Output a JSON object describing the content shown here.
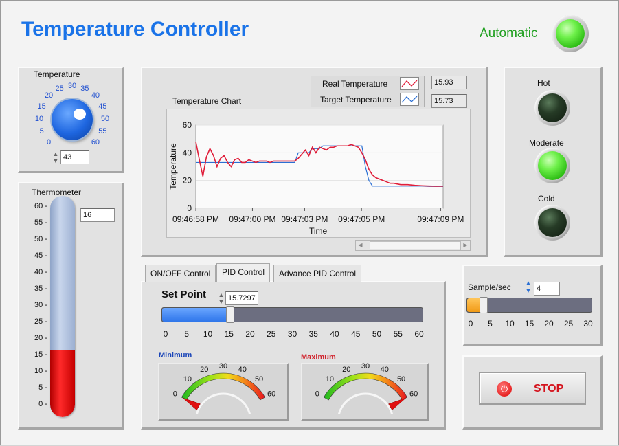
{
  "header": {
    "title": "Temperature Controller",
    "mode_label": "Automatic"
  },
  "colors": {
    "title": "#1a73e8",
    "mode": "#22a022",
    "real_temp": "#e01e3a",
    "target_temp": "#2a6fd4",
    "slider_fill": "#3b82f6",
    "thermo_mercury": "#e00000"
  },
  "knob": {
    "label": "Temperature",
    "ticks": [
      "0",
      "5",
      "10",
      "15",
      "20",
      "25",
      "30",
      "35",
      "40",
      "45",
      "50",
      "55",
      "60"
    ],
    "value": "43"
  },
  "thermometer": {
    "label": "Thermometer",
    "ticks": [
      "60",
      "55",
      "50",
      "45",
      "40",
      "35",
      "30",
      "25",
      "20",
      "15",
      "10",
      "5",
      "0"
    ],
    "value": "16",
    "level": 16,
    "max": 60
  },
  "chart": {
    "title": "Temperature Chart",
    "legend": [
      {
        "name": "Real Temperature",
        "value": "15.93"
      },
      {
        "name": "Target Temperature",
        "value": "15.73"
      }
    ],
    "x_ticks": [
      "09:46:58 PM",
      "09:47:00 PM",
      "09:47:03 PM",
      "09:47:05 PM",
      "09:47:09 PM"
    ],
    "y_ticks": [
      "60",
      "40",
      "20",
      "0"
    ]
  },
  "chart_data": {
    "type": "line",
    "xlabel": "Time",
    "ylabel": "Temperature",
    "ylim": [
      0,
      60
    ],
    "grid": true,
    "legend_position": "top-right",
    "x": [
      0,
      0.5,
      1,
      1.5,
      2,
      2.5,
      3,
      3.5,
      4,
      4.5,
      5,
      5.5,
      6,
      6.5,
      7,
      7.5,
      8,
      8.5,
      9,
      9.5,
      10,
      10.5,
      11,
      11.5,
      12,
      12.5,
      13,
      13.5,
      14,
      14.5,
      15,
      15.5,
      16,
      16.5,
      17,
      17.5,
      18,
      18.5,
      19,
      19.5,
      20,
      20.5,
      21,
      21.5,
      22,
      22.5,
      23,
      23.5,
      24,
      24.5,
      25,
      25.5,
      26,
      26.5,
      27,
      27.5,
      28,
      29,
      30,
      31,
      32,
      33,
      34,
      35
    ],
    "series": [
      {
        "name": "Real Temperature",
        "values": [
          48,
          35,
          23,
          37,
          43,
          38,
          30,
          36,
          38,
          33,
          30,
          35,
          36,
          33,
          33,
          35,
          34,
          33,
          34,
          34,
          34,
          33,
          34,
          34,
          34,
          34,
          34,
          34,
          34,
          36,
          39,
          42,
          38,
          44,
          40,
          44,
          43,
          42,
          44,
          44,
          45,
          45,
          45,
          45,
          46,
          45,
          44,
          40,
          35,
          28,
          24,
          22,
          21,
          20,
          19,
          18,
          18,
          17,
          17,
          16.5,
          16.2,
          16.0,
          15.9,
          15.93
        ]
      },
      {
        "name": "Target Temperature",
        "values": [
          33,
          33,
          33,
          33,
          33,
          33,
          33,
          33,
          33,
          33,
          33,
          33,
          33,
          33,
          33,
          33,
          33,
          33,
          33,
          33,
          33,
          33,
          33,
          33,
          33,
          33,
          33,
          33,
          33,
          40,
          40,
          40,
          40,
          43,
          43,
          43,
          45,
          45,
          45,
          45,
          45,
          45,
          45,
          45,
          45,
          45,
          45,
          45,
          30,
          20,
          16,
          16,
          16,
          16,
          16,
          16,
          16,
          16,
          16,
          16,
          16,
          15.73,
          15.73,
          15.73
        ]
      }
    ]
  },
  "leds": {
    "hot": "Hot",
    "moderate": "Moderate",
    "cold": "Cold",
    "hot_state": "off",
    "moderate_state": "on",
    "cold_state": "off"
  },
  "tabs": [
    "ON/OFF Control",
    "PID Control",
    "Advance PID Control"
  ],
  "pid": {
    "setpoint_label": "Set Point",
    "setpoint_value": "15.7297",
    "slider_ticks": [
      "0",
      "5",
      "10",
      "15",
      "20",
      "25",
      "30",
      "35",
      "40",
      "45",
      "50",
      "55",
      "60"
    ],
    "slider_level": 15.73,
    "slider_max": 60,
    "min_label": "Minimum",
    "max_label": "Maximum",
    "gauge_ticks": [
      "0",
      "10",
      "20",
      "30",
      "40",
      "50",
      "60"
    ],
    "min_needle": 0,
    "max_needle": 60
  },
  "sample": {
    "label": "Sample/sec",
    "value": "4",
    "ticks": [
      "0",
      "5",
      "10",
      "15",
      "20",
      "25",
      "30"
    ],
    "level": 4,
    "max": 30
  },
  "stop": {
    "label": "STOP"
  }
}
